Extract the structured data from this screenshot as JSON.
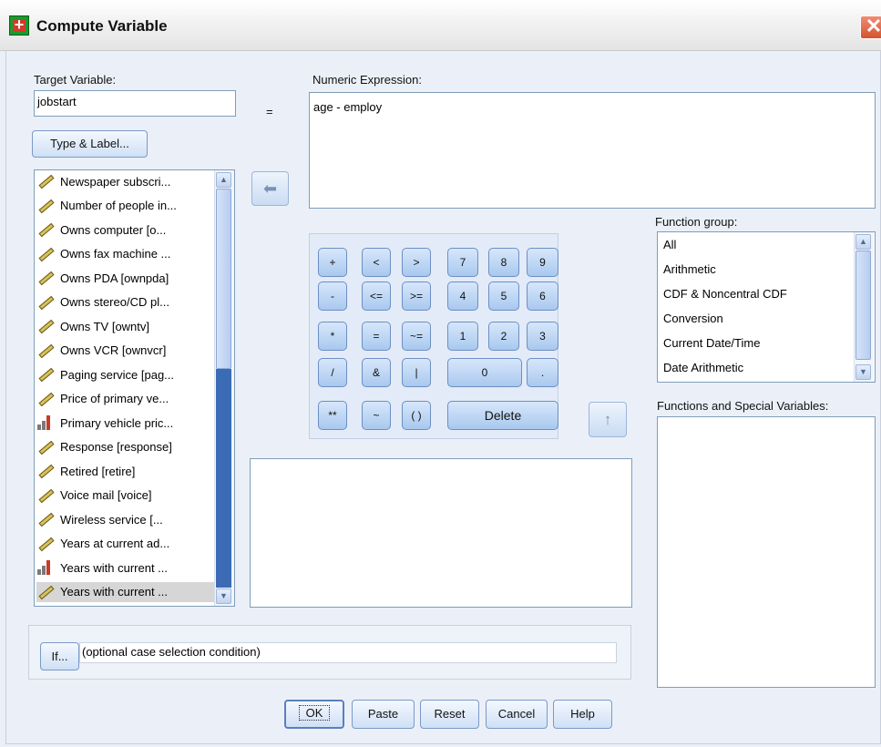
{
  "window": {
    "title": "Compute Variable",
    "close_glyph": "✕"
  },
  "target_variable": {
    "label": "Target Variable:",
    "value": "jobstart"
  },
  "equals_sign": "=",
  "type_label_button": "Type & Label...",
  "numeric_expression": {
    "label": "Numeric Expression:",
    "value": "age - employ"
  },
  "transfer_arrow_glyph": "⬅",
  "up_arrow_glyph": "↑",
  "variables": [
    {
      "label": "Newspaper subscri...",
      "type": "ruler-icon"
    },
    {
      "label": "Number of people in...",
      "type": "ruler-icon"
    },
    {
      "label": "Owns computer [o...",
      "type": "ruler-icon"
    },
    {
      "label": "Owns fax machine ...",
      "type": "ruler-icon"
    },
    {
      "label": "Owns PDA [ownpda]",
      "type": "ruler-icon"
    },
    {
      "label": "Owns stereo/CD pl...",
      "type": "ruler-icon"
    },
    {
      "label": "Owns TV [owntv]",
      "type": "ruler-icon"
    },
    {
      "label": "Owns VCR [ownvcr]",
      "type": "ruler-icon"
    },
    {
      "label": "Paging service [pag...",
      "type": "ruler-icon"
    },
    {
      "label": "Price of primary ve...",
      "type": "ruler-icon"
    },
    {
      "label": "Primary vehicle pric...",
      "type": "bar-chart-icon"
    },
    {
      "label": "Response [response]",
      "type": "ruler-icon"
    },
    {
      "label": "Retired [retire]",
      "type": "ruler-icon"
    },
    {
      "label": "Voice mail [voice]",
      "type": "ruler-icon"
    },
    {
      "label": "Wireless service [...",
      "type": "ruler-icon"
    },
    {
      "label": "Years at current ad...",
      "type": "ruler-icon"
    },
    {
      "label": "Years with current ...",
      "type": "bar-chart-icon"
    },
    {
      "label": "Years with current ...",
      "type": "ruler-icon",
      "selected": true
    }
  ],
  "keypad": {
    "plus": "+",
    "lt": "<",
    "gt": ">",
    "seven": "7",
    "eight": "8",
    "nine": "9",
    "minus": "-",
    "le": "<=",
    "ge": ">=",
    "four": "4",
    "five": "5",
    "six": "6",
    "times": "*",
    "eq": "=",
    "ne": "~=",
    "one": "1",
    "two": "2",
    "three": "3",
    "divide": "/",
    "and": "&",
    "or": "|",
    "zero": "0",
    "dot": ".",
    "power": "**",
    "not": "~",
    "parens": "( )",
    "delete": "Delete"
  },
  "function_group": {
    "label": "Function group:",
    "items": [
      "All",
      "Arithmetic",
      "CDF & Noncentral CDF",
      "Conversion",
      "Current Date/Time",
      "Date Arithmetic"
    ]
  },
  "functions_special": {
    "label": "Functions and Special Variables:"
  },
  "if_section": {
    "button": "If...",
    "condition": "(optional case selection condition)"
  },
  "footer_buttons": {
    "ok": "OK",
    "paste": "Paste",
    "reset": "Reset",
    "cancel": "Cancel",
    "help": "Help"
  },
  "colors": {
    "client_bg": "#ebf0f8",
    "button_blue": "#a9c8ee",
    "scroll_thumb": "#3c6bb5",
    "selected_row": "#d6d6d6"
  }
}
